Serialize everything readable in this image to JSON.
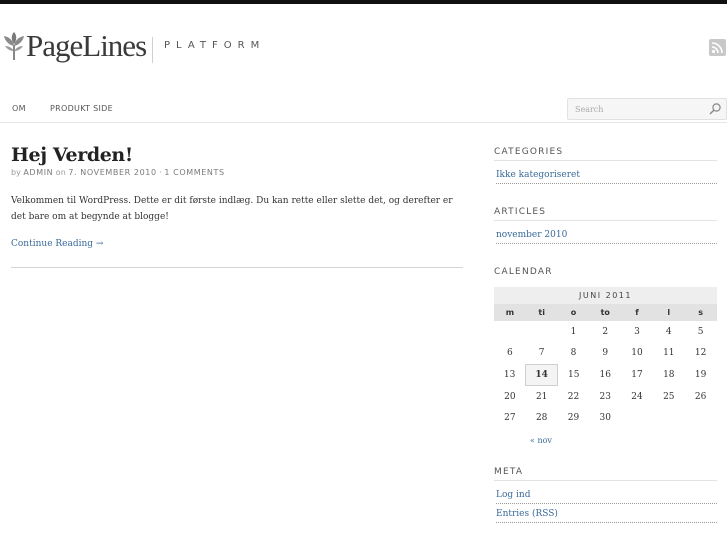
{
  "header": {
    "logo_text": "PageLines",
    "tagline": "PLATFORM"
  },
  "nav": {
    "items": [
      "OM",
      "PRODUKT SIDE"
    ],
    "search_placeholder": "Search"
  },
  "post": {
    "title": "Hej Verden!",
    "meta_by": "by",
    "meta_author": "ADMIN",
    "meta_on": "on",
    "meta_date": "7. NOVEMBER 2010",
    "meta_sep": "·",
    "meta_comments": "1 COMMENTS",
    "body": "Velkommen til WordPress. Dette er dit første indlæg. Du kan rette eller slette det, og derefter er det bare om at begynde at blogge!",
    "continue": "Continue Reading →"
  },
  "sidebar": {
    "categories": {
      "heading": "CATEGORIES",
      "items": [
        "Ikke kategoriseret"
      ]
    },
    "articles": {
      "heading": "ARTICLES",
      "items": [
        "november 2010"
      ]
    },
    "calendar": {
      "heading": "CALENDAR",
      "caption": "JUNI 2011",
      "weekdays": [
        "m",
        "ti",
        "o",
        "to",
        "f",
        "l",
        "s"
      ],
      "weeks": [
        [
          "",
          "",
          "1",
          "2",
          "3",
          "4",
          "5"
        ],
        [
          "6",
          "7",
          "8",
          "9",
          "10",
          "11",
          "12"
        ],
        [
          "13",
          "14",
          "15",
          "16",
          "17",
          "18",
          "19"
        ],
        [
          "20",
          "21",
          "22",
          "23",
          "24",
          "25",
          "26"
        ],
        [
          "27",
          "28",
          "29",
          "30",
          "",
          "",
          ""
        ]
      ],
      "today": "14",
      "prev_link": "« nov"
    },
    "meta": {
      "heading": "META",
      "items": [
        "Log ind",
        "Entries (RSS)"
      ]
    }
  },
  "icons": {
    "logo": "leaf-icon",
    "rss": "rss-icon",
    "search": "search-icon"
  },
  "colors": {
    "link": "#3a6a9a",
    "topbar": "#111111"
  }
}
